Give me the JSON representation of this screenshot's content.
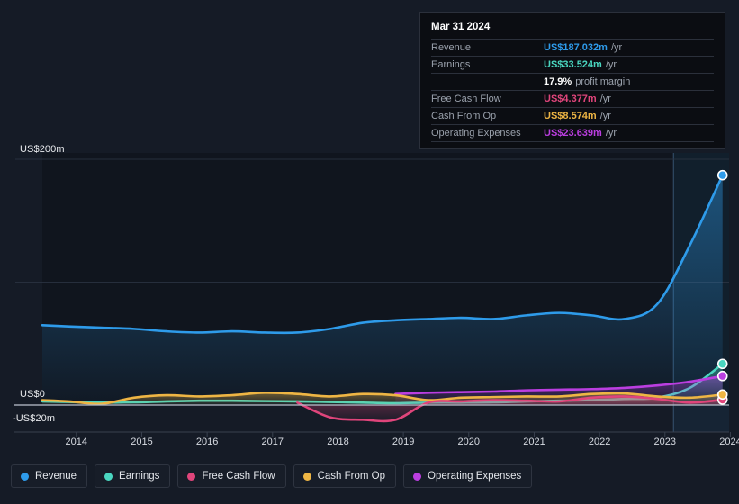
{
  "colors": {
    "revenue": "#2e9bea",
    "earnings": "#4ad6c0",
    "free_cash_flow": "#e0457b",
    "cash_from_op": "#eeb544",
    "operating_expenses": "#bb3ee0",
    "background": "#151b26",
    "tooltip_bg": "#0b0d12",
    "grid": "#2b3342",
    "zero_line": "#b9c0cc"
  },
  "tooltip": {
    "date": "Mar 31 2024",
    "rows": [
      {
        "label": "Revenue",
        "value": "US$187.032m",
        "unit": "/yr",
        "color": "#2e9bea"
      },
      {
        "label": "Earnings",
        "value": "US$33.524m",
        "unit": "/yr",
        "color": "#4ad6c0"
      },
      {
        "label": "",
        "value": "17.9%",
        "unit": "profit margin",
        "color": "#ffffff"
      },
      {
        "label": "Free Cash Flow",
        "value": "US$4.377m",
        "unit": "/yr",
        "color": "#e0457b"
      },
      {
        "label": "Cash From Op",
        "value": "US$8.574m",
        "unit": "/yr",
        "color": "#eeb544"
      },
      {
        "label": "Operating Expenses",
        "value": "US$23.639m",
        "unit": "/yr",
        "color": "#bb3ee0"
      }
    ]
  },
  "legend": [
    {
      "label": "Revenue",
      "color": "#2e9bea"
    },
    {
      "label": "Earnings",
      "color": "#4ad6c0"
    },
    {
      "label": "Free Cash Flow",
      "color": "#e0457b"
    },
    {
      "label": "Cash From Op",
      "color": "#eeb544"
    },
    {
      "label": "Operating Expenses",
      "color": "#bb3ee0"
    }
  ],
  "axes": {
    "y_labels": [
      "US$200m",
      "US$0",
      "-US$20m"
    ],
    "x_labels": [
      "2014",
      "2015",
      "2016",
      "2017",
      "2018",
      "2019",
      "2020",
      "2021",
      "2022",
      "2023",
      "2024"
    ]
  },
  "chart_data": {
    "type": "area",
    "title": "",
    "xlabel": "",
    "ylabel": "US$m",
    "ylim": [
      -20,
      200
    ],
    "grid": true,
    "legend_position": "bottom",
    "y_ticks": [
      200,
      0,
      -20
    ],
    "x": [
      2013.6,
      2014,
      2014.5,
      2015,
      2015.5,
      2016,
      2016.5,
      2017,
      2017.5,
      2018,
      2018.5,
      2019,
      2019.5,
      2020,
      2020.5,
      2021,
      2021.5,
      2022,
      2022.5,
      2023,
      2023.5,
      2024.0
    ],
    "highlight_band": {
      "from": 2023.25,
      "to": 2024.1
    },
    "series": [
      {
        "name": "Revenue",
        "color": "#2e9bea",
        "values": [
          65,
          64,
          63,
          62,
          60,
          59,
          60,
          59,
          59,
          62,
          67,
          69,
          70,
          71,
          70,
          73,
          75,
          73,
          70,
          82,
          130,
          187.032
        ]
      },
      {
        "name": "Earnings",
        "color": "#4ad6c0",
        "values": [
          3,
          2.5,
          2,
          2.2,
          3,
          3.5,
          3.5,
          3.2,
          3,
          2.5,
          2,
          1.5,
          2,
          2,
          2.2,
          3,
          3.5,
          4,
          5,
          6,
          14,
          33.524
        ]
      },
      {
        "name": "Free Cash Flow",
        "color": "#e0457b",
        "values": [
          null,
          null,
          null,
          null,
          null,
          null,
          null,
          null,
          2,
          -10,
          -12,
          -12,
          2,
          3,
          4,
          3.5,
          3,
          6,
          7,
          5,
          2,
          4.377
        ]
      },
      {
        "name": "Cash From Op",
        "color": "#eeb544",
        "values": [
          4,
          3,
          1,
          6,
          8,
          7,
          8,
          10,
          9,
          7,
          9,
          8,
          4,
          6,
          6.5,
          7,
          7,
          9,
          9.5,
          7,
          6,
          8.574
        ]
      },
      {
        "name": "Operating Expenses",
        "color": "#bb3ee0",
        "values": [
          null,
          null,
          null,
          null,
          null,
          null,
          null,
          null,
          null,
          null,
          null,
          9,
          10,
          10.5,
          11,
          12,
          12.5,
          13,
          14,
          16,
          19,
          23.639
        ]
      }
    ]
  }
}
